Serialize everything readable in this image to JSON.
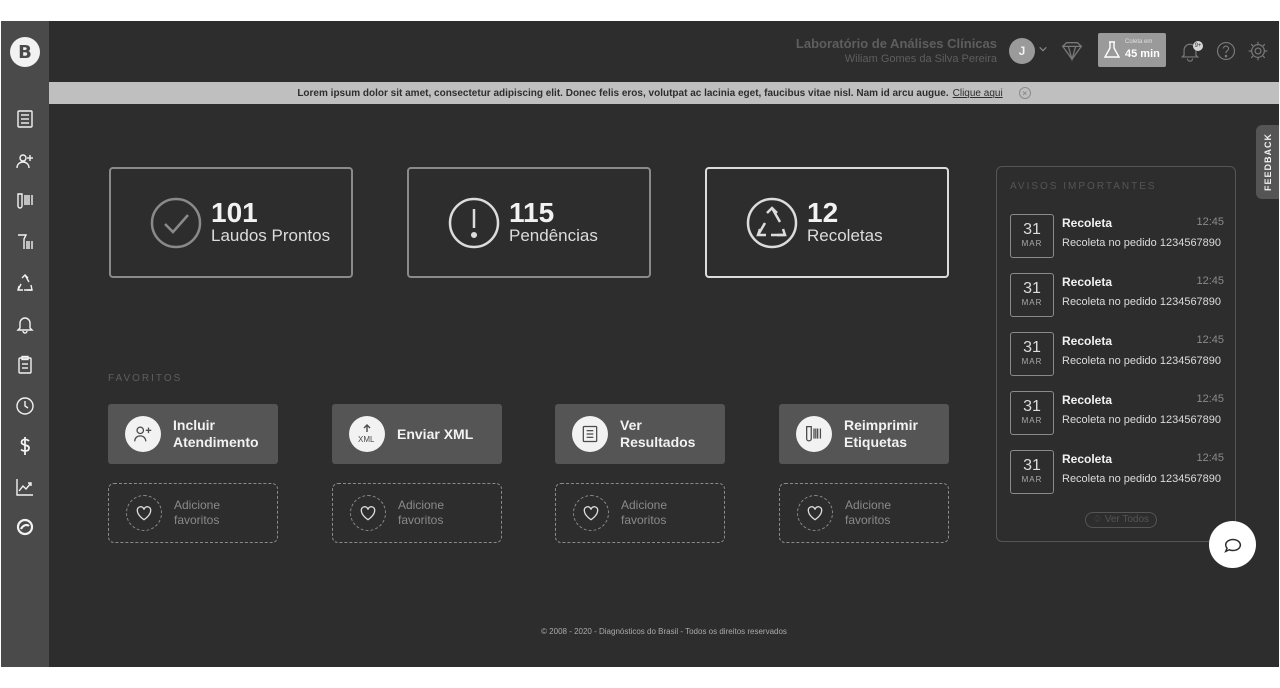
{
  "header": {
    "lab_name": "Laboratório de Análises Clínicas",
    "user_name": "Wiliam Gomes da Silva Pereira",
    "avatar_initial": "J",
    "coleta_label": "Coleta em",
    "coleta_value": "45 min",
    "notification_count": "9+"
  },
  "banner": {
    "text": "Lorem ipsum dolor sit amet, consectetur adipiscing elit. Donec felis eros, volutpat ac lacinia eget, faucibus vitae nisl. Nam id arcu augue.",
    "link": "Clique aqui"
  },
  "stats": [
    {
      "number": "101",
      "label": "Laudos Prontos",
      "icon": "check-circle-icon"
    },
    {
      "number": "115",
      "label": "Pendências",
      "icon": "exclamation-circle-icon"
    },
    {
      "number": "12",
      "label": "Recoletas",
      "icon": "recycle-icon"
    }
  ],
  "favorites": {
    "title": "FAVORITOS",
    "items": [
      {
        "label": "Incluir Atendimento",
        "icon": "add-patient-icon"
      },
      {
        "label": "Enviar XML",
        "icon": "xml-upload-icon"
      },
      {
        "label": "Ver Resultados",
        "icon": "results-list-icon"
      },
      {
        "label": "Reimprimir Etiquetas",
        "icon": "barcode-tube-icon"
      }
    ],
    "add_label": "Adicione favoritos"
  },
  "avisos": {
    "title": "AVISOS IMPORTANTES",
    "items": [
      {
        "day": "31",
        "month": "MAR",
        "title": "Recoleta",
        "time": "12:45",
        "desc": "Recoleta no pedido 1234567890"
      },
      {
        "day": "31",
        "month": "MAR",
        "title": "Recoleta",
        "time": "12:45",
        "desc": "Recoleta no pedido 1234567890"
      },
      {
        "day": "31",
        "month": "MAR",
        "title": "Recoleta",
        "time": "12:45",
        "desc": "Recoleta no pedido 1234567890"
      },
      {
        "day": "31",
        "month": "MAR",
        "title": "Recoleta",
        "time": "12:45",
        "desc": "Recoleta no pedido 1234567890"
      },
      {
        "day": "31",
        "month": "MAR",
        "title": "Recoleta",
        "time": "12:45",
        "desc": "Recoleta no pedido 1234567890"
      }
    ],
    "ver_todos": "Ver Todos"
  },
  "feedback": "FEEDBACK",
  "footer": "© 2008 - 2020 - Diagnósticos do Brasil - Todos os direitos reservados",
  "sidebar": {
    "icons": [
      "list-icon",
      "add-user-icon",
      "barcode-icon",
      "tube-barcode-icon",
      "recycle-icon",
      "bell-icon",
      "clipboard-icon",
      "clock-icon",
      "dollar-icon",
      "chart-icon",
      "globe-icon"
    ]
  },
  "colors": {
    "background": "#2d2d2d",
    "sidebar": "#4a4a4a",
    "banner": "#bfbfbf",
    "card_border": "#8a8a8a",
    "button": "#555555"
  }
}
